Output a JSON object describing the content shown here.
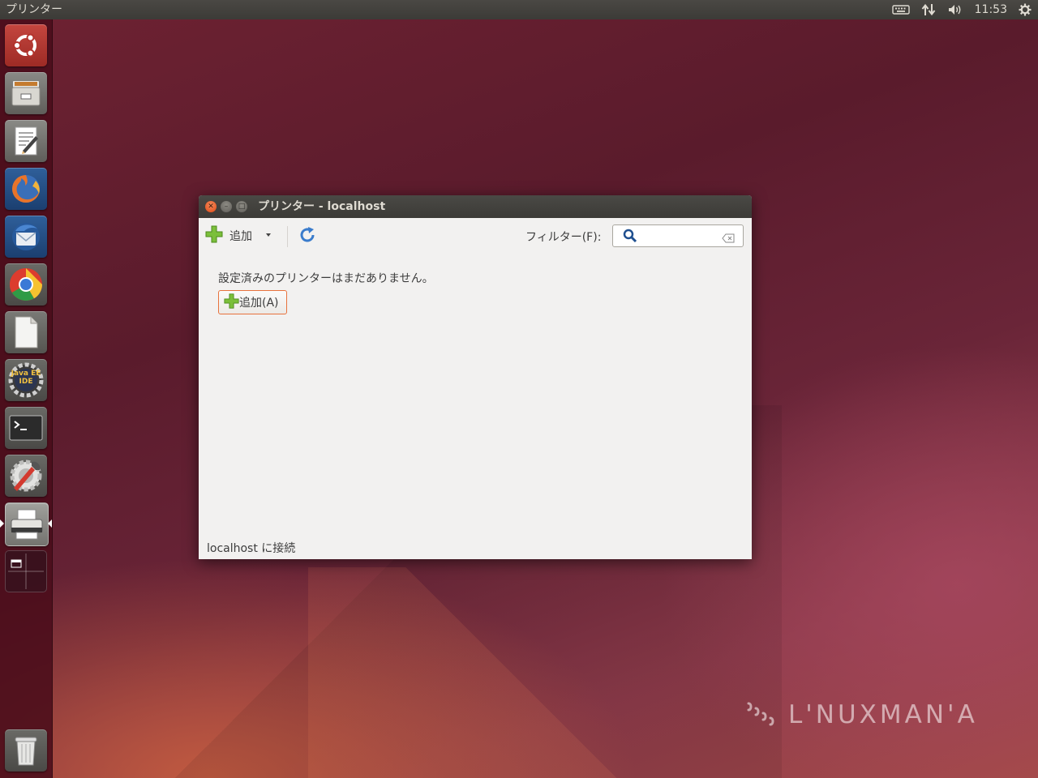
{
  "top_panel": {
    "app_title": "プリンター",
    "clock": "11:53",
    "icons": [
      "keyboard-icon",
      "network-icon",
      "volume-icon",
      "gear-icon"
    ]
  },
  "launcher": {
    "items": [
      "ubuntu-dash-icon",
      "files-icon",
      "text-editor-icon",
      "firefox-icon",
      "thunderbird-icon",
      "chrome-icon",
      "libreoffice-icon",
      "java-ee-ide-icon",
      "terminal-icon",
      "system-settings-icon",
      "printer-icon",
      "workspace-switcher-icon",
      "trash-icon"
    ],
    "java_ide_label_1": "Java EE",
    "java_ide_label_2": "IDE"
  },
  "window": {
    "title": "プリンター - localhost",
    "toolbar": {
      "add_label": "追加",
      "filter_label": "フィルター(F):",
      "filter_value": ""
    },
    "empty_message": "設定済みのプリンターはまだありません。",
    "add_button_label": "追加(A)",
    "status": "localhost に接続"
  },
  "wallpaper": {
    "brand": "L'NUXMAN'A"
  },
  "colors": {
    "accent": "#e8733d",
    "panel": "#3c3b37",
    "window_bg": "#f2f1f0",
    "add_green": "#6cad2e",
    "refresh_blue": "#3a7ccc"
  }
}
